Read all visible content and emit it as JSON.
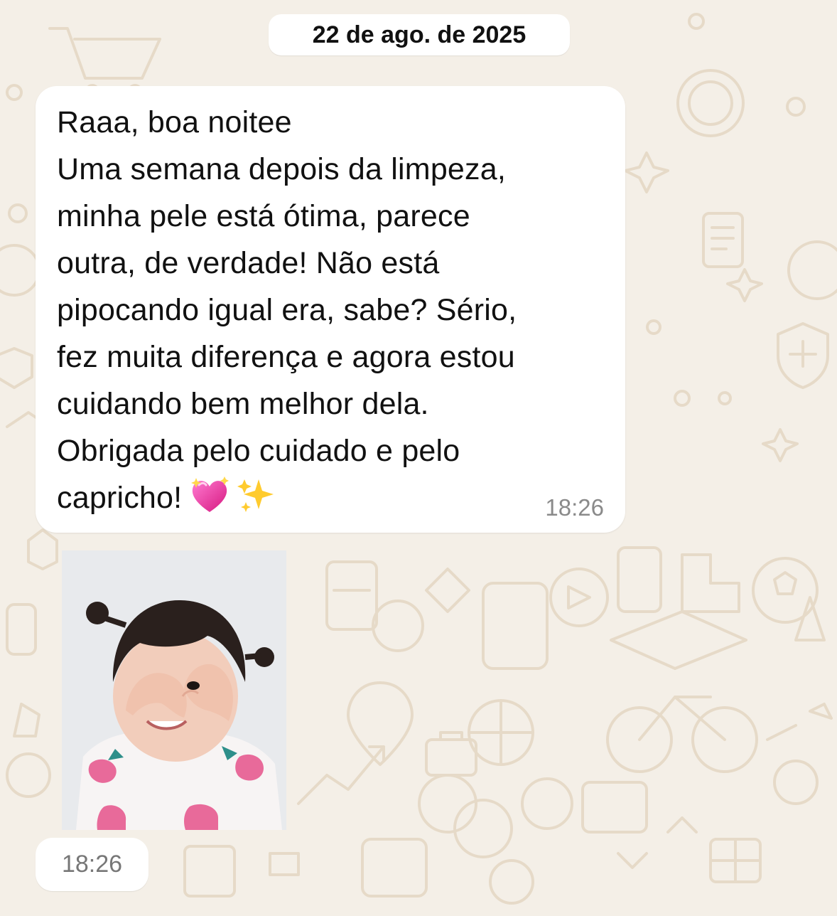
{
  "chat": {
    "date_separator": "22 de ago. de 2025",
    "message": {
      "lines": [
        "Raaa, boa noitee",
        "Uma semana depois da limpeza,",
        "minha pele está ótima, parece",
        "outra, de verdade! Não está",
        "pipocando igual era, sabe? Sério,",
        "fez muita diferença e agora estou",
        "cuidando bem melhor dela.",
        "Obrigada pelo cuidado e pelo",
        "capricho!"
      ],
      "emojis": [
        "sparkling-heart-icon",
        "sparkles-icon"
      ],
      "time": "18:26"
    },
    "photo_message": {
      "time": "18:26"
    }
  },
  "theme": {
    "background": "#f4efe7",
    "doodle_color": "#e8ddcc",
    "bubble_color": "#ffffff",
    "timestamp_color": "#8a8a8a"
  }
}
